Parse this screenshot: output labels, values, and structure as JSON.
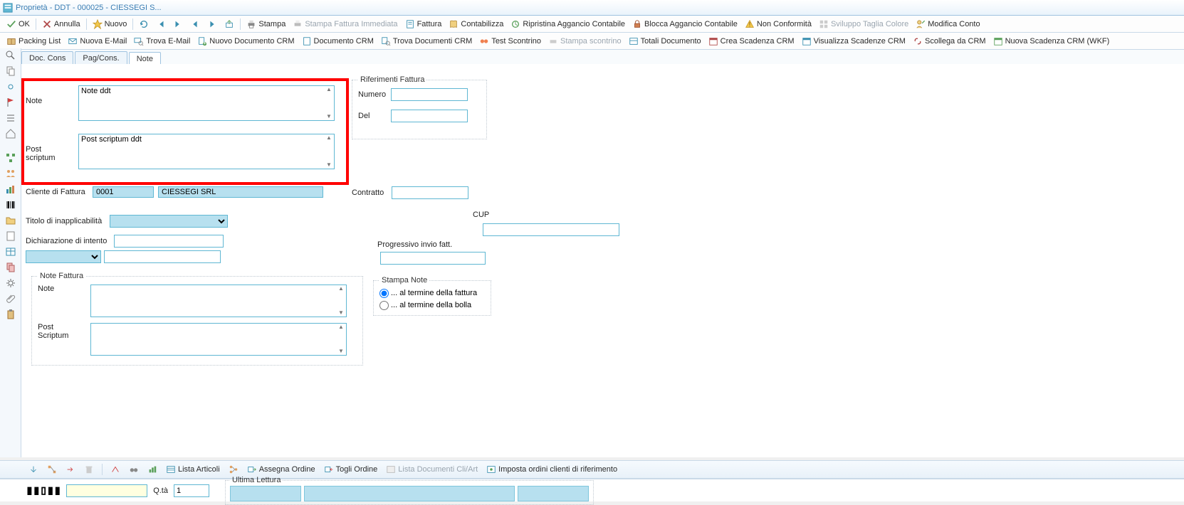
{
  "window": {
    "title": "Proprietà - DDT - 000025 - CIESSEGI S..."
  },
  "toolbar1": {
    "ok": "OK",
    "annulla": "Annulla",
    "nuovo": "Nuovo",
    "stampa": "Stampa",
    "stampa_fattura_imm": "Stampa Fattura Immediata",
    "fattura": "Fattura",
    "contabilizza": "Contabilizza",
    "ripristina": "Ripristina Aggancio Contabile",
    "blocca": "Blocca Aggancio Contabile",
    "non_conformita": "Non Conformità",
    "sviluppo": "Sviluppo Taglia Colore",
    "modifica_conto": "Modifica Conto"
  },
  "toolbar2": {
    "packing": "Packing List",
    "nuova_email": "Nuova E-Mail",
    "trova_email": "Trova E-Mail",
    "nuovo_doc_crm": "Nuovo Documento CRM",
    "documento_crm": "Documento CRM",
    "trova_doc_crm": "Trova Documenti CRM",
    "test_scontrino": "Test Scontrino",
    "stampa_scontrino": "Stampa scontrino",
    "totali_doc": "Totali Documento",
    "crea_scadenza": "Crea Scadenza CRM",
    "visualizza_scadenze": "Visualizza Scadenze CRM",
    "scollega_crm": "Scollega da CRM",
    "nuova_scadenza_wkf": "Nuova Scadenza CRM (WKF)"
  },
  "tabs": {
    "doc_cons": "Doc. Cons",
    "pag_cons": "Pag/Cons.",
    "note": "Note"
  },
  "form": {
    "note_label": "Note",
    "note_value": "Note ddt",
    "ps_label": "Post scriptum",
    "ps_value": "Post scriptum ddt",
    "rif_fattura": "Riferimenti Fattura",
    "numero": "Numero",
    "del": "Del",
    "cliente_fattura": "Cliente di Fattura",
    "cliente_code": "0001",
    "cliente_name": "CIESSEGI SRL",
    "contratto": "Contratto",
    "titolo_inapp": "Titolo di inapplicabilità",
    "cup": "CUP",
    "dich_intento": "Dichiarazione di intento",
    "prog_invio": "Progressivo invio fatt.",
    "note_fattura": "Note Fattura",
    "note2_label": "Note",
    "ps2_label": "Post Scriptum",
    "stampa_note": "Stampa Note",
    "radio1": "... al termine della fattura",
    "radio2": "... al termine della bolla"
  },
  "bottombar": {
    "lista_articoli": "Lista Articoli",
    "assegna_ordine": "Assegna Ordine",
    "togli_ordine": "Togli Ordine",
    "lista_doc_cliart": "Lista Documenti Cli/Art",
    "imposta_ordini": "Imposta ordini clienti di riferimento"
  },
  "status": {
    "qta": "Q.tà",
    "qta_val": "1",
    "ultima_lettura": "Ultima Lettura"
  }
}
